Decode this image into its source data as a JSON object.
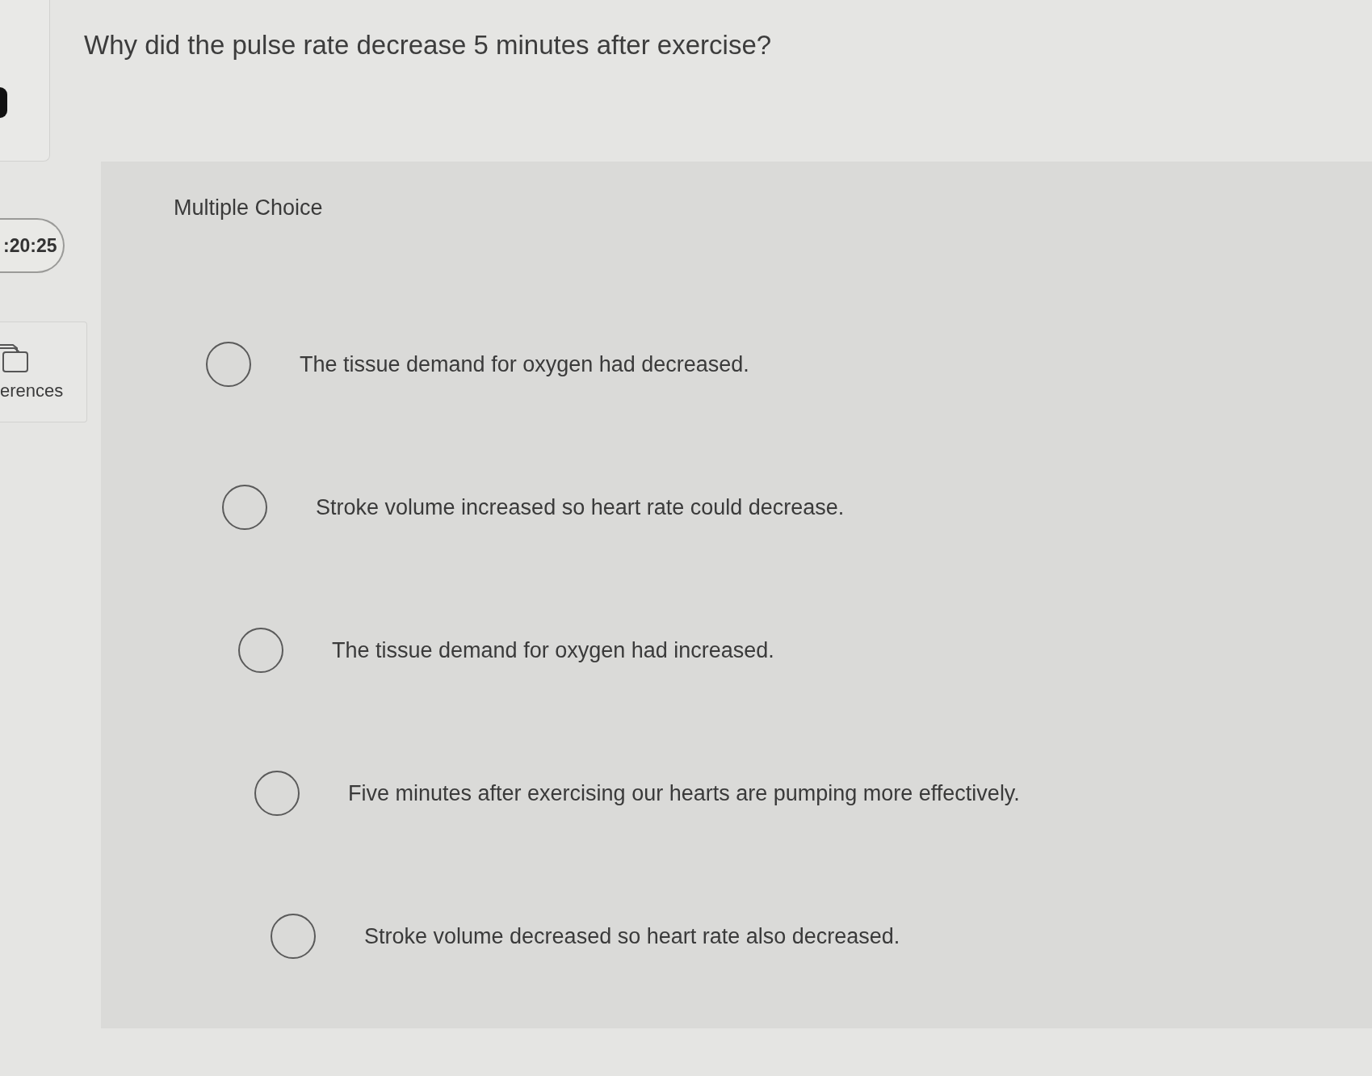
{
  "sidebar": {
    "timer": ":20:25",
    "references_button": {
      "label": "erences"
    }
  },
  "question": {
    "prompt": "Why did the pulse rate decrease 5 minutes after exercise?",
    "type_label": "Multiple Choice",
    "options": [
      {
        "label": "The tissue demand for oxygen had decreased.",
        "selected": false
      },
      {
        "label": "Stroke volume increased so heart rate could decrease.",
        "selected": false
      },
      {
        "label": "The tissue demand for oxygen had increased.",
        "selected": false
      },
      {
        "label": "Five minutes after exercising our hearts are pumping more effectively.",
        "selected": false
      },
      {
        "label": "Stroke volume decreased so heart rate also decreased.",
        "selected": false
      }
    ]
  }
}
